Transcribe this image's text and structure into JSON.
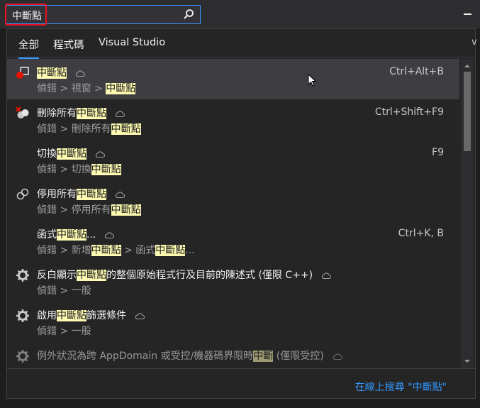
{
  "search": {
    "query": "中斷點"
  },
  "tabs": [
    {
      "label": "全部",
      "active": true
    },
    {
      "label": "程式碼",
      "active": false
    },
    {
      "label": "Visual Studio",
      "active": false
    }
  ],
  "edge_char": "v",
  "results": [
    {
      "icon": "breakpoint-window-icon",
      "title": [
        "",
        "中斷點",
        ""
      ],
      "path": [
        "偵錯 > 視窗 > ",
        "中斷點",
        ""
      ],
      "shortcut": "Ctrl+Alt+B",
      "cloud": true,
      "selected": true
    },
    {
      "icon": "delete-breakpoints-icon",
      "title": [
        "刪除所有",
        "中斷點",
        ""
      ],
      "path": [
        "偵錯 > 刪除所有",
        "中斷點",
        ""
      ],
      "shortcut": "Ctrl+Shift+F9",
      "cloud": true
    },
    {
      "icon": "",
      "title": [
        "切換",
        "中斷點",
        ""
      ],
      "path": [
        "偵錯 > 切換",
        "中斷點",
        ""
      ],
      "shortcut": "F9",
      "cloud": true
    },
    {
      "icon": "disable-breakpoints-icon",
      "title": [
        "停用所有",
        "中斷點",
        ""
      ],
      "path": [
        "偵錯 > 停用所有",
        "中斷點",
        ""
      ],
      "shortcut": "",
      "cloud": true
    },
    {
      "icon": "",
      "title": [
        "函式",
        "中斷點",
        "..."
      ],
      "path": [
        "偵錯 > 新增",
        "中斷點",
        " > 函式",
        "中斷點",
        "..."
      ],
      "shortcut": "Ctrl+K, B",
      "cloud": true
    },
    {
      "icon": "gear-icon",
      "title": [
        "反白顯示",
        "中斷點",
        "的整個原始程式行及目前的陳述式 (僅限 C++)"
      ],
      "path": [
        "偵錯 > 一般"
      ],
      "shortcut": "",
      "cloud": true
    },
    {
      "icon": "gear-icon",
      "title": [
        "啟用",
        "中斷點",
        "篩選條件"
      ],
      "path": [
        "偵錯 > 一般"
      ],
      "shortcut": "",
      "cloud": true
    },
    {
      "icon": "gear-icon",
      "title": [
        "例外狀況為跨 AppDomain 或受控/機器碼界限時",
        "中斷",
        " (僅限受控)"
      ],
      "path": [],
      "shortcut": "",
      "cloud": true,
      "dim": true
    }
  ],
  "footer": {
    "online_search_label": "在線上搜尋 \"中斷點\""
  }
}
